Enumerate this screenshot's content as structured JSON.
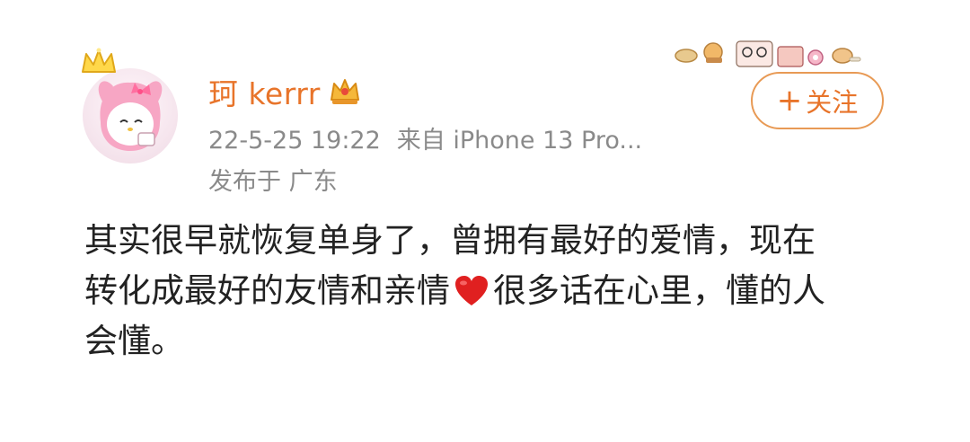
{
  "user": {
    "name": "珂 kerrr",
    "avatar_icon": "my-melody-avatar-icon",
    "badge_icon": "vip-crown-icon"
  },
  "post_meta": {
    "time": "22-5-25 19:22",
    "source": "来自 iPhone 13 Pro...",
    "location": "发布于 广东"
  },
  "follow_button": {
    "label": "关注",
    "plus": "+"
  },
  "post": {
    "line1": "其实很早就恢复单身了，曾拥有最好的爱情，现在",
    "line2_before": "转化成最好的友情和亲情",
    "line2_after": "很多话在心里，懂的人",
    "line3": "会懂。",
    "emoji_icon": "red-heart-icon"
  },
  "colors": {
    "accent": "#e8742a",
    "follow_border": "#e89a55",
    "meta_text": "#8a8a8a",
    "body_text": "#222222",
    "heart": "#e02020"
  }
}
